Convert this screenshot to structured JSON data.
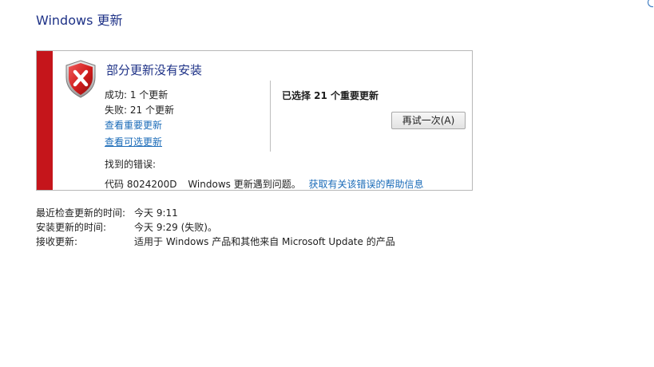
{
  "page": {
    "title": "Windows 更新"
  },
  "status_box": {
    "heading": "部分更新没有安装",
    "success_text": "成功: 1 个更新",
    "failure_text": "失败: 21 个更新",
    "view_important_link": "查看重要更新",
    "view_optional_link": "查看可选更新",
    "errors_label": "找到的错误:",
    "error_code": "代码 8024200D",
    "error_message": "Windows 更新遇到问题。",
    "error_help_link": "获取有关该错误的帮助信息",
    "selected_text": "已选择 21 个重要更新",
    "retry_button": "再试一次(A)",
    "accent_color": "#c5151b",
    "icon": "error-shield-icon"
  },
  "info": {
    "rows": [
      {
        "label": "最近检查更新的时间:",
        "value": "今天 9:11"
      },
      {
        "label": "安装更新的时间:",
        "value": "今天 9:29 (失败)。"
      },
      {
        "label": "接收更新:",
        "value": "适用于 Windows 产品和其他来自 Microsoft Update 的产品"
      }
    ]
  }
}
